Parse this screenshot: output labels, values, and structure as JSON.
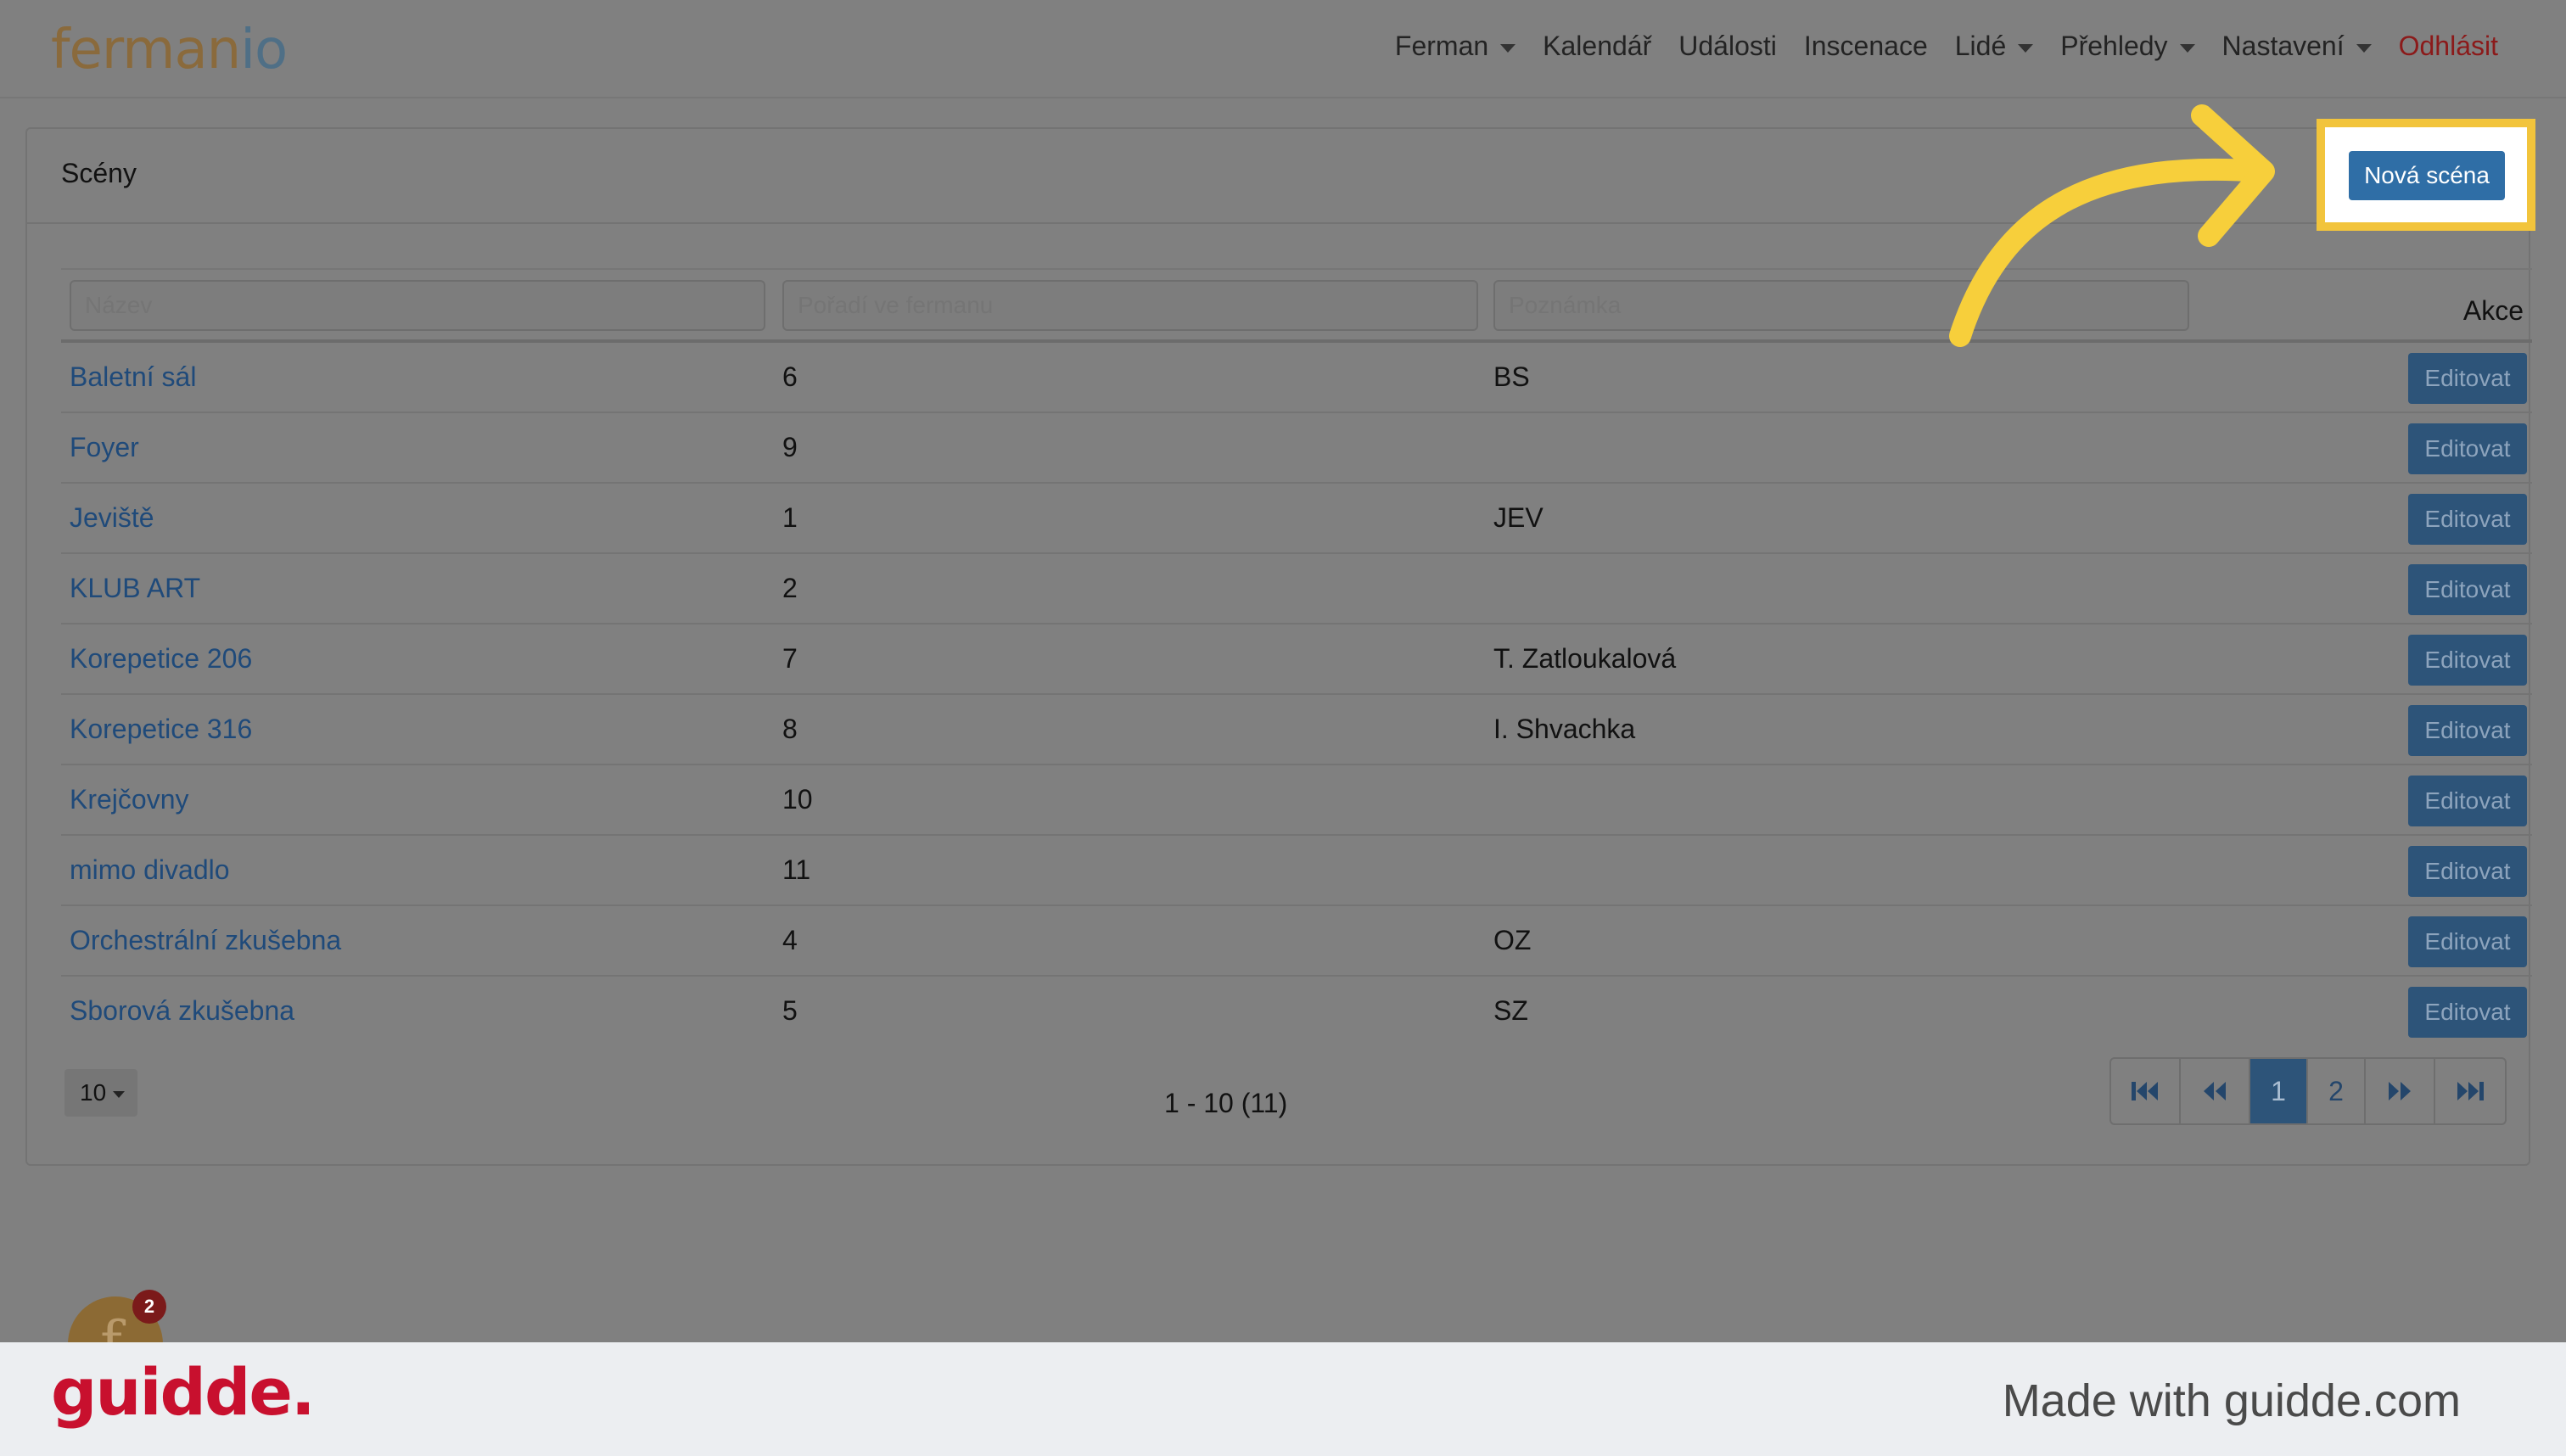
{
  "app": {
    "brand_part1": "ferman",
    "brand_part2": "io"
  },
  "nav": {
    "items": [
      {
        "label": "Ferman",
        "dropdown": true
      },
      {
        "label": "Kalendář",
        "dropdown": false
      },
      {
        "label": "Události",
        "dropdown": false
      },
      {
        "label": "Inscenace",
        "dropdown": false
      },
      {
        "label": "Lidé",
        "dropdown": true
      },
      {
        "label": "Přehledy",
        "dropdown": true
      },
      {
        "label": "Nastavení",
        "dropdown": true
      }
    ],
    "logout": "Odhlásit"
  },
  "card": {
    "title": "Scény",
    "new_button": "Nová scéna"
  },
  "table": {
    "filters": {
      "name_placeholder": "Název",
      "order_placeholder": "Pořadí ve fermanu",
      "note_placeholder": "Poznámka"
    },
    "actions_header": "Akce",
    "edit_label": "Editovat",
    "rows": [
      {
        "name": "Baletní sál",
        "order": "6",
        "note": "BS"
      },
      {
        "name": "Foyer",
        "order": "9",
        "note": ""
      },
      {
        "name": "Jeviště",
        "order": "1",
        "note": "JEV"
      },
      {
        "name": "KLUB ART",
        "order": "2",
        "note": ""
      },
      {
        "name": "Korepetice 206",
        "order": "7",
        "note": "T. Zatloukalová"
      },
      {
        "name": "Korepetice 316",
        "order": "8",
        "note": "I. Shvachka"
      },
      {
        "name": "Krejčovny",
        "order": "10",
        "note": ""
      },
      {
        "name": "mimo divadlo",
        "order": "11",
        "note": ""
      },
      {
        "name": "Orchestrální zkušebna",
        "order": "4",
        "note": "OZ"
      },
      {
        "name": "Sborová zkušebna",
        "order": "5",
        "note": "SZ"
      }
    ]
  },
  "pagination": {
    "page_size": "10",
    "range": "1 - 10 (11)",
    "pages": [
      "1",
      "2"
    ],
    "current_page": "1"
  },
  "badge": {
    "glyph": "f",
    "count": "2"
  },
  "footer": {
    "logo": "guidde.",
    "tagline": "Made with guidde.com"
  },
  "colors": {
    "highlight": "#f2c43c",
    "primary_button": "#2f6ea6",
    "logout": "#8b1a1a",
    "footer_logo": "#c8102e"
  }
}
